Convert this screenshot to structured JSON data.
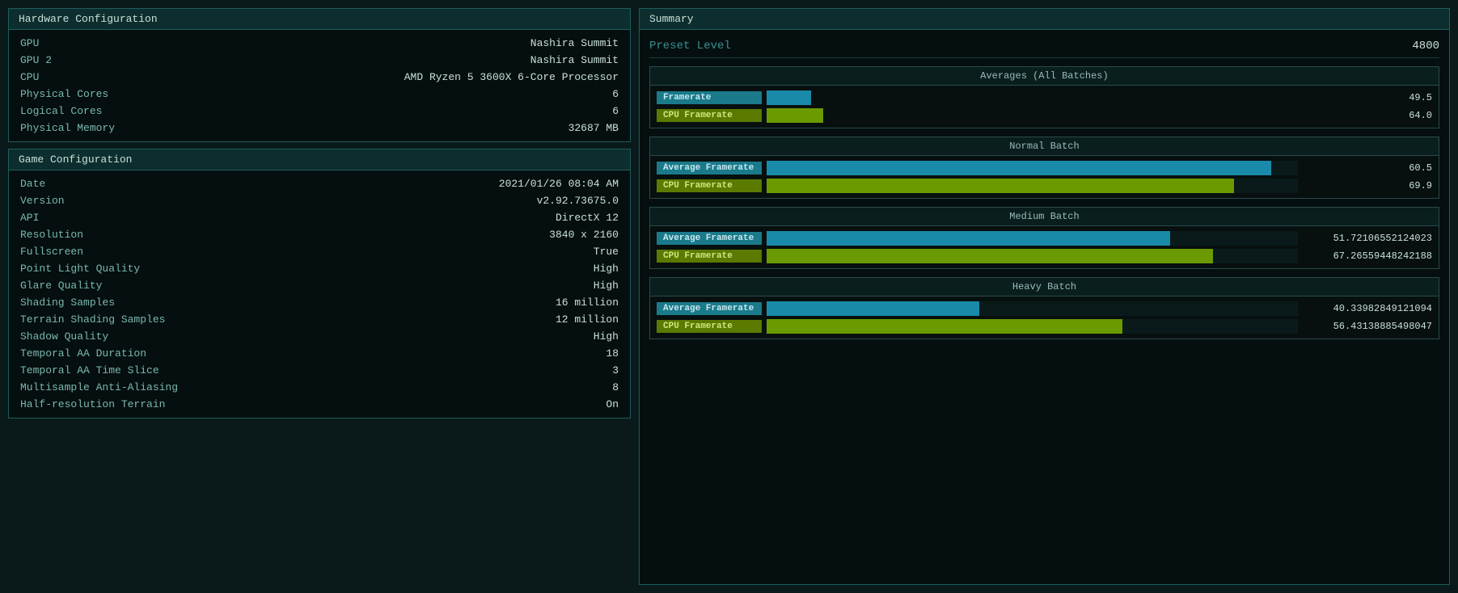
{
  "hardware": {
    "title": "Hardware Configuration",
    "rows": [
      {
        "label": "GPU",
        "value": "Nashira Summit",
        "highlight": false
      },
      {
        "label": "GPU 2",
        "value": "Nashira Summit",
        "highlight": false
      },
      {
        "label": "CPU",
        "value": "AMD Ryzen 5 3600X 6-Core Processor",
        "highlight": false
      },
      {
        "label": "Physical Cores",
        "value": "6",
        "highlight": true
      },
      {
        "label": "Logical Cores",
        "value": "6",
        "highlight": true
      },
      {
        "label": "Physical Memory",
        "value": "32687 MB",
        "highlight": true
      }
    ]
  },
  "game": {
    "title": "Game Configuration",
    "rows": [
      {
        "label": "Date",
        "value": "2021/01/26 08:04 AM",
        "highlight": false
      },
      {
        "label": "Version",
        "value": "v2.92.73675.0",
        "highlight": false
      },
      {
        "label": "API",
        "value": "DirectX 12",
        "highlight": false
      },
      {
        "label": "Resolution",
        "value": "3840 x 2160",
        "highlight": false
      },
      {
        "label": "Fullscreen",
        "value": "True",
        "highlight": false
      },
      {
        "label": "Point Light Quality",
        "value": "High",
        "highlight": true
      },
      {
        "label": "Glare Quality",
        "value": "High",
        "highlight": true
      },
      {
        "label": "Shading Samples",
        "value": "16 million",
        "highlight": false
      },
      {
        "label": "Terrain Shading Samples",
        "value": "12 million",
        "highlight": true
      },
      {
        "label": "Shadow Quality",
        "value": "High",
        "highlight": false
      },
      {
        "label": "Temporal AA Duration",
        "value": "18",
        "highlight": true
      },
      {
        "label": "Temporal AA Time Slice",
        "value": "3",
        "highlight": true
      },
      {
        "label": "Multisample Anti-Aliasing",
        "value": "8",
        "highlight": true
      },
      {
        "label": "Half-resolution Terrain",
        "value": "On",
        "highlight": true
      }
    ]
  },
  "summary": {
    "title": "Summary",
    "preset_label": "Preset Level",
    "preset_value": "4800",
    "averages": {
      "header": "Averages (All Batches)",
      "framerate_label": "Framerate",
      "framerate_value": "49.5",
      "cpu_framerate_label": "CPU Framerate",
      "cpu_framerate_value": "64.0"
    },
    "normal_batch": {
      "header": "Normal Batch",
      "avg_label": "Average Framerate",
      "avg_value": "60.5",
      "avg_pct": 95,
      "cpu_label": "CPU Framerate",
      "cpu_value": "69.9",
      "cpu_pct": 90
    },
    "medium_batch": {
      "header": "Medium Batch",
      "avg_label": "Average Framerate",
      "avg_value": "51.72106552124023",
      "avg_pct": 78,
      "cpu_label": "CPU Framerate",
      "cpu_value": "67.26559448242188",
      "cpu_pct": 86
    },
    "heavy_batch": {
      "header": "Heavy Batch",
      "avg_label": "Average Framerate",
      "avg_value": "40.33982849121094",
      "avg_pct": 42,
      "cpu_label": "CPU Framerate",
      "cpu_value": "56.43138885498047",
      "cpu_pct": 70
    }
  }
}
